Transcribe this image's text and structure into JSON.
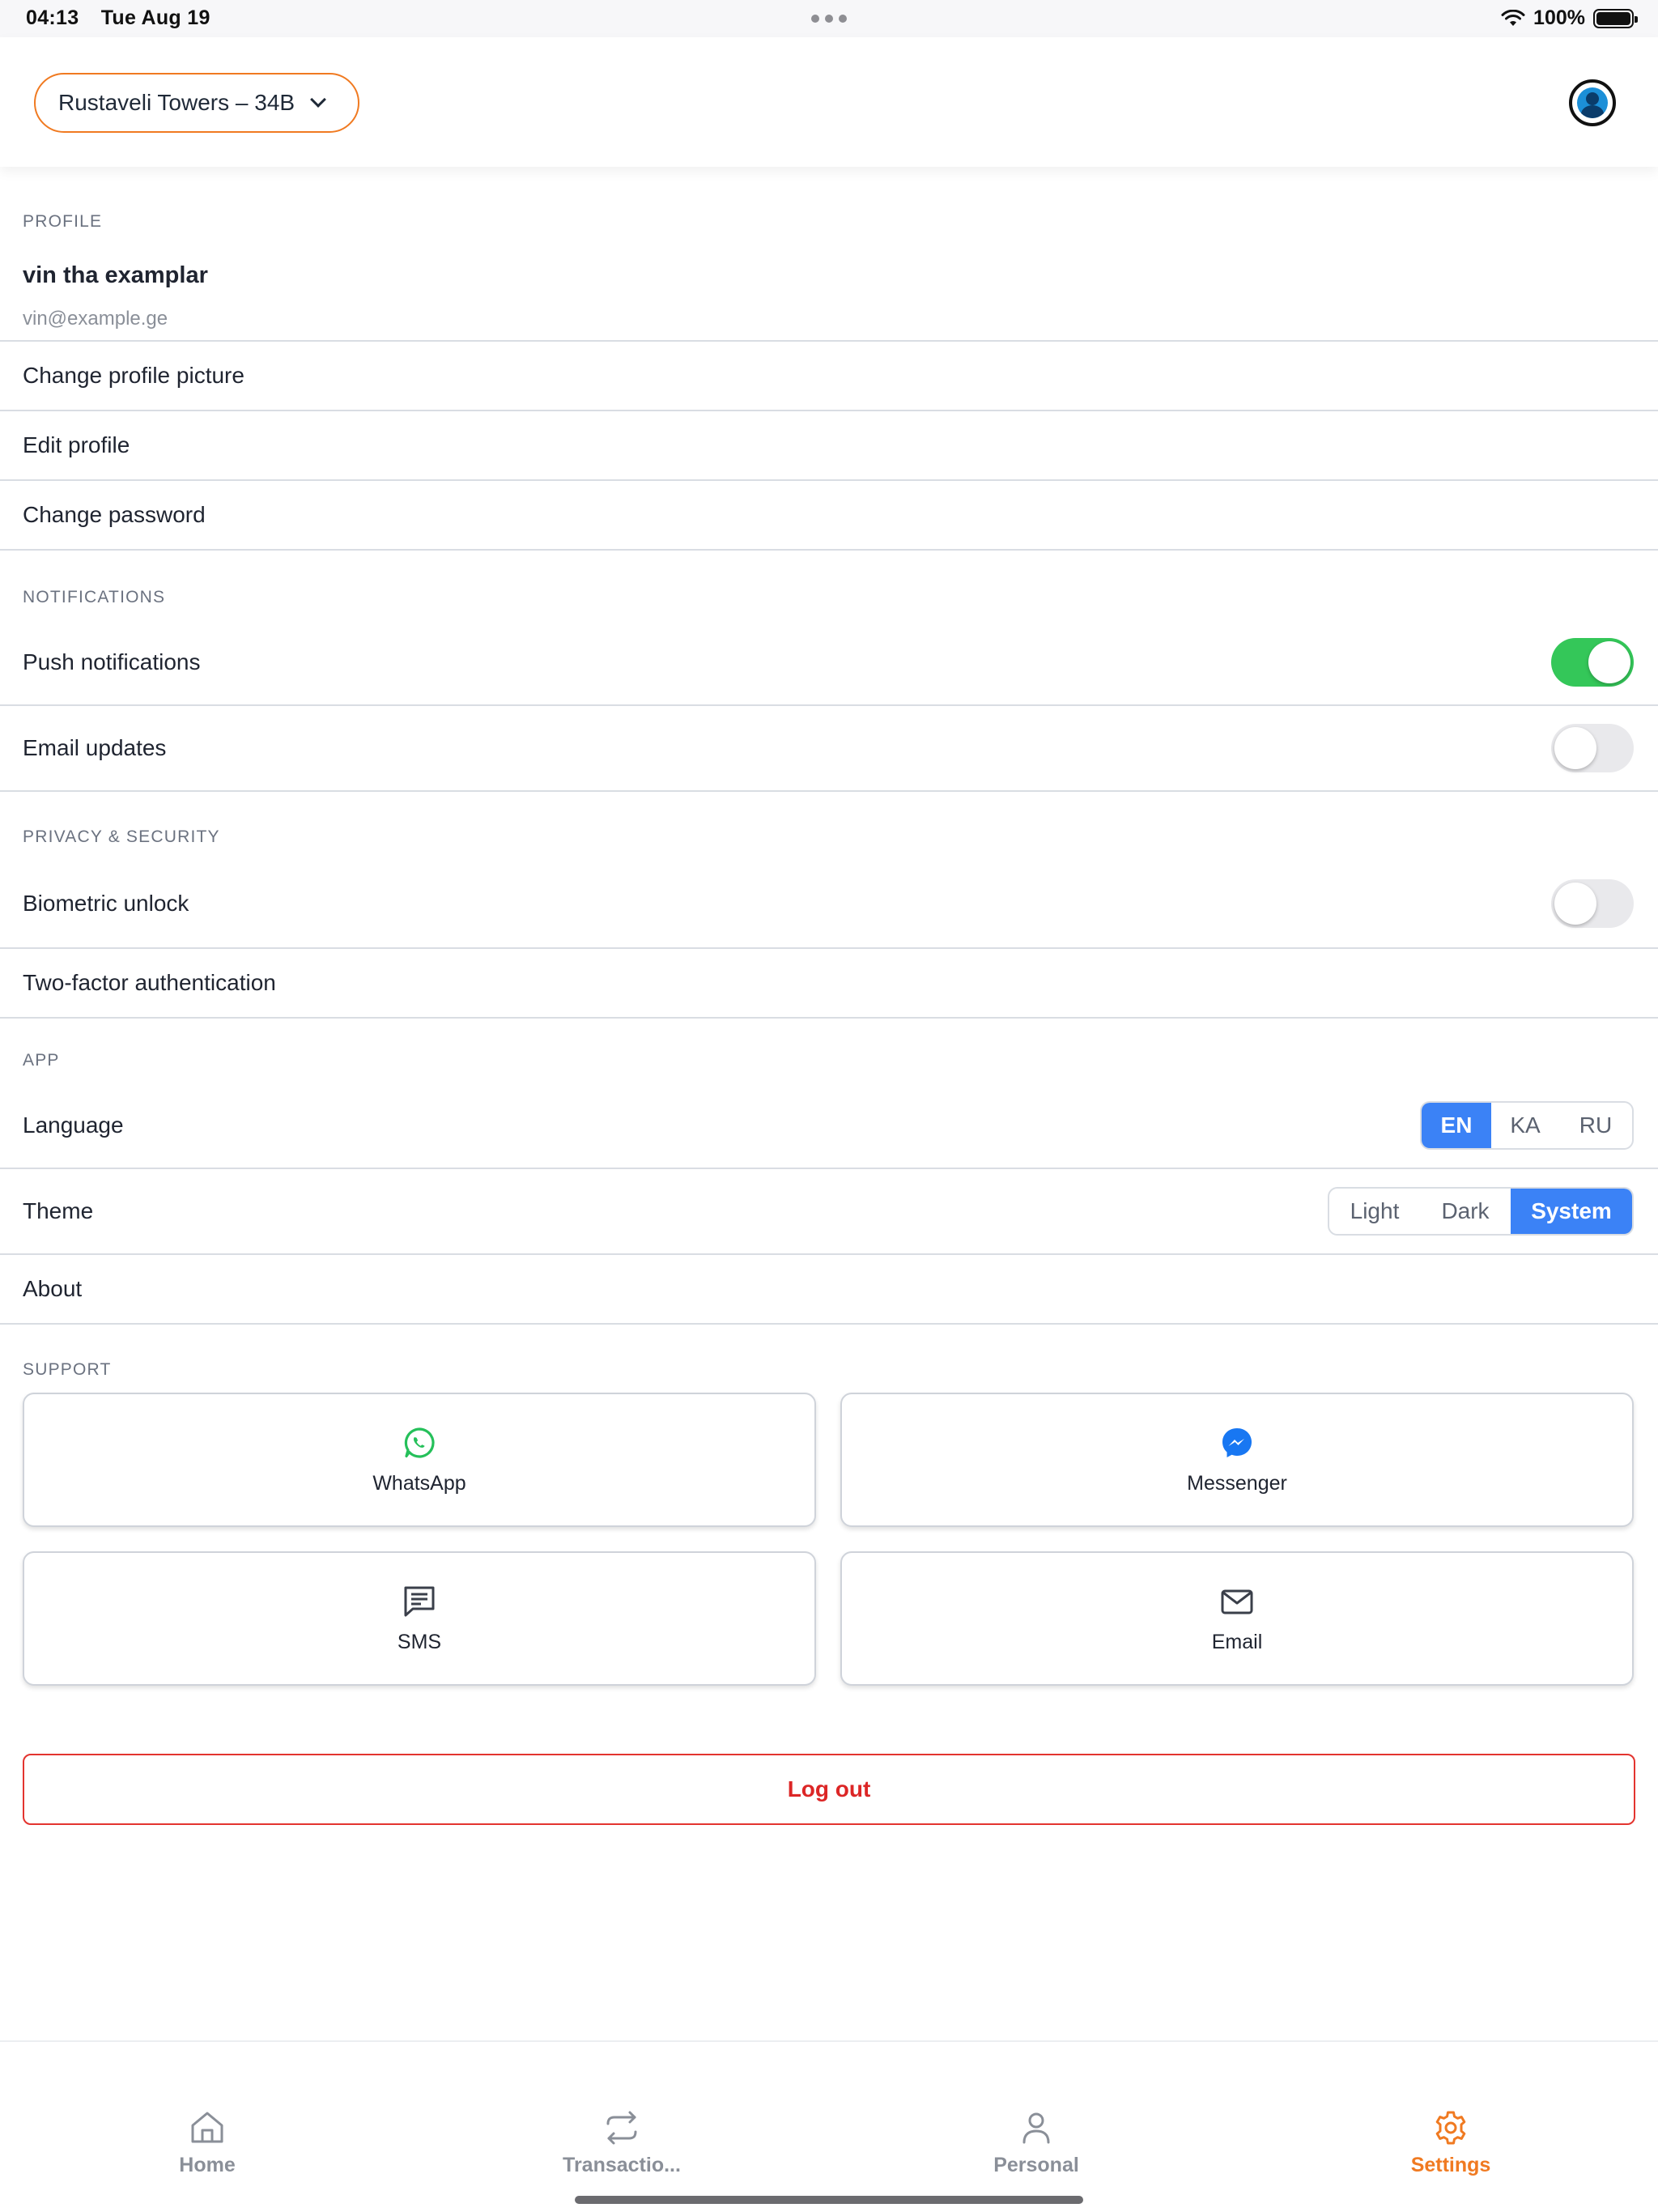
{
  "status_bar": {
    "time": "04:13",
    "date": "Tue Aug 19",
    "battery_text": "100%"
  },
  "header": {
    "property_selector": "Rustaveli Towers – 34B"
  },
  "profile": {
    "section_title": "PROFILE",
    "name": "vin tha examplar",
    "email": "vin@example.ge",
    "items": [
      "Change profile picture",
      "Edit profile",
      "Change password"
    ]
  },
  "notifications": {
    "section_title": "NOTIFICATIONS",
    "push_label": "Push notifications",
    "push_enabled": true,
    "email_label": "Email updates",
    "email_enabled": false
  },
  "privacy": {
    "section_title": "PRIVACY & SECURITY",
    "biometric_label": "Biometric unlock",
    "biometric_enabled": false,
    "two_factor_label": "Two-factor authentication"
  },
  "app": {
    "section_title": "APP",
    "language_label": "Language",
    "languages": [
      "EN",
      "KA",
      "RU"
    ],
    "selected_language": "EN",
    "theme_label": "Theme",
    "themes": [
      "Light",
      "Dark",
      "System"
    ],
    "selected_theme": "System",
    "about_label": "About"
  },
  "support": {
    "section_title": "SUPPORT",
    "channels": [
      {
        "label": "WhatsApp",
        "icon": "whatsapp-icon"
      },
      {
        "label": "Messenger",
        "icon": "messenger-icon"
      },
      {
        "label": "SMS",
        "icon": "sms-icon"
      },
      {
        "label": "Email",
        "icon": "mail-icon"
      }
    ]
  },
  "logout_label": "Log out",
  "tabs": [
    {
      "label": "Home",
      "icon": "home-icon",
      "active": false
    },
    {
      "label": "Transactio...",
      "icon": "transactions-icon",
      "active": false
    },
    {
      "label": "Personal",
      "icon": "person-icon",
      "active": false
    },
    {
      "label": "Settings",
      "icon": "gear-icon",
      "active": true
    }
  ],
  "colors": {
    "accent_orange": "#f07a21",
    "selected_blue": "#3b82f6",
    "toggle_green": "#34c759",
    "danger_red": "#dc2626"
  }
}
